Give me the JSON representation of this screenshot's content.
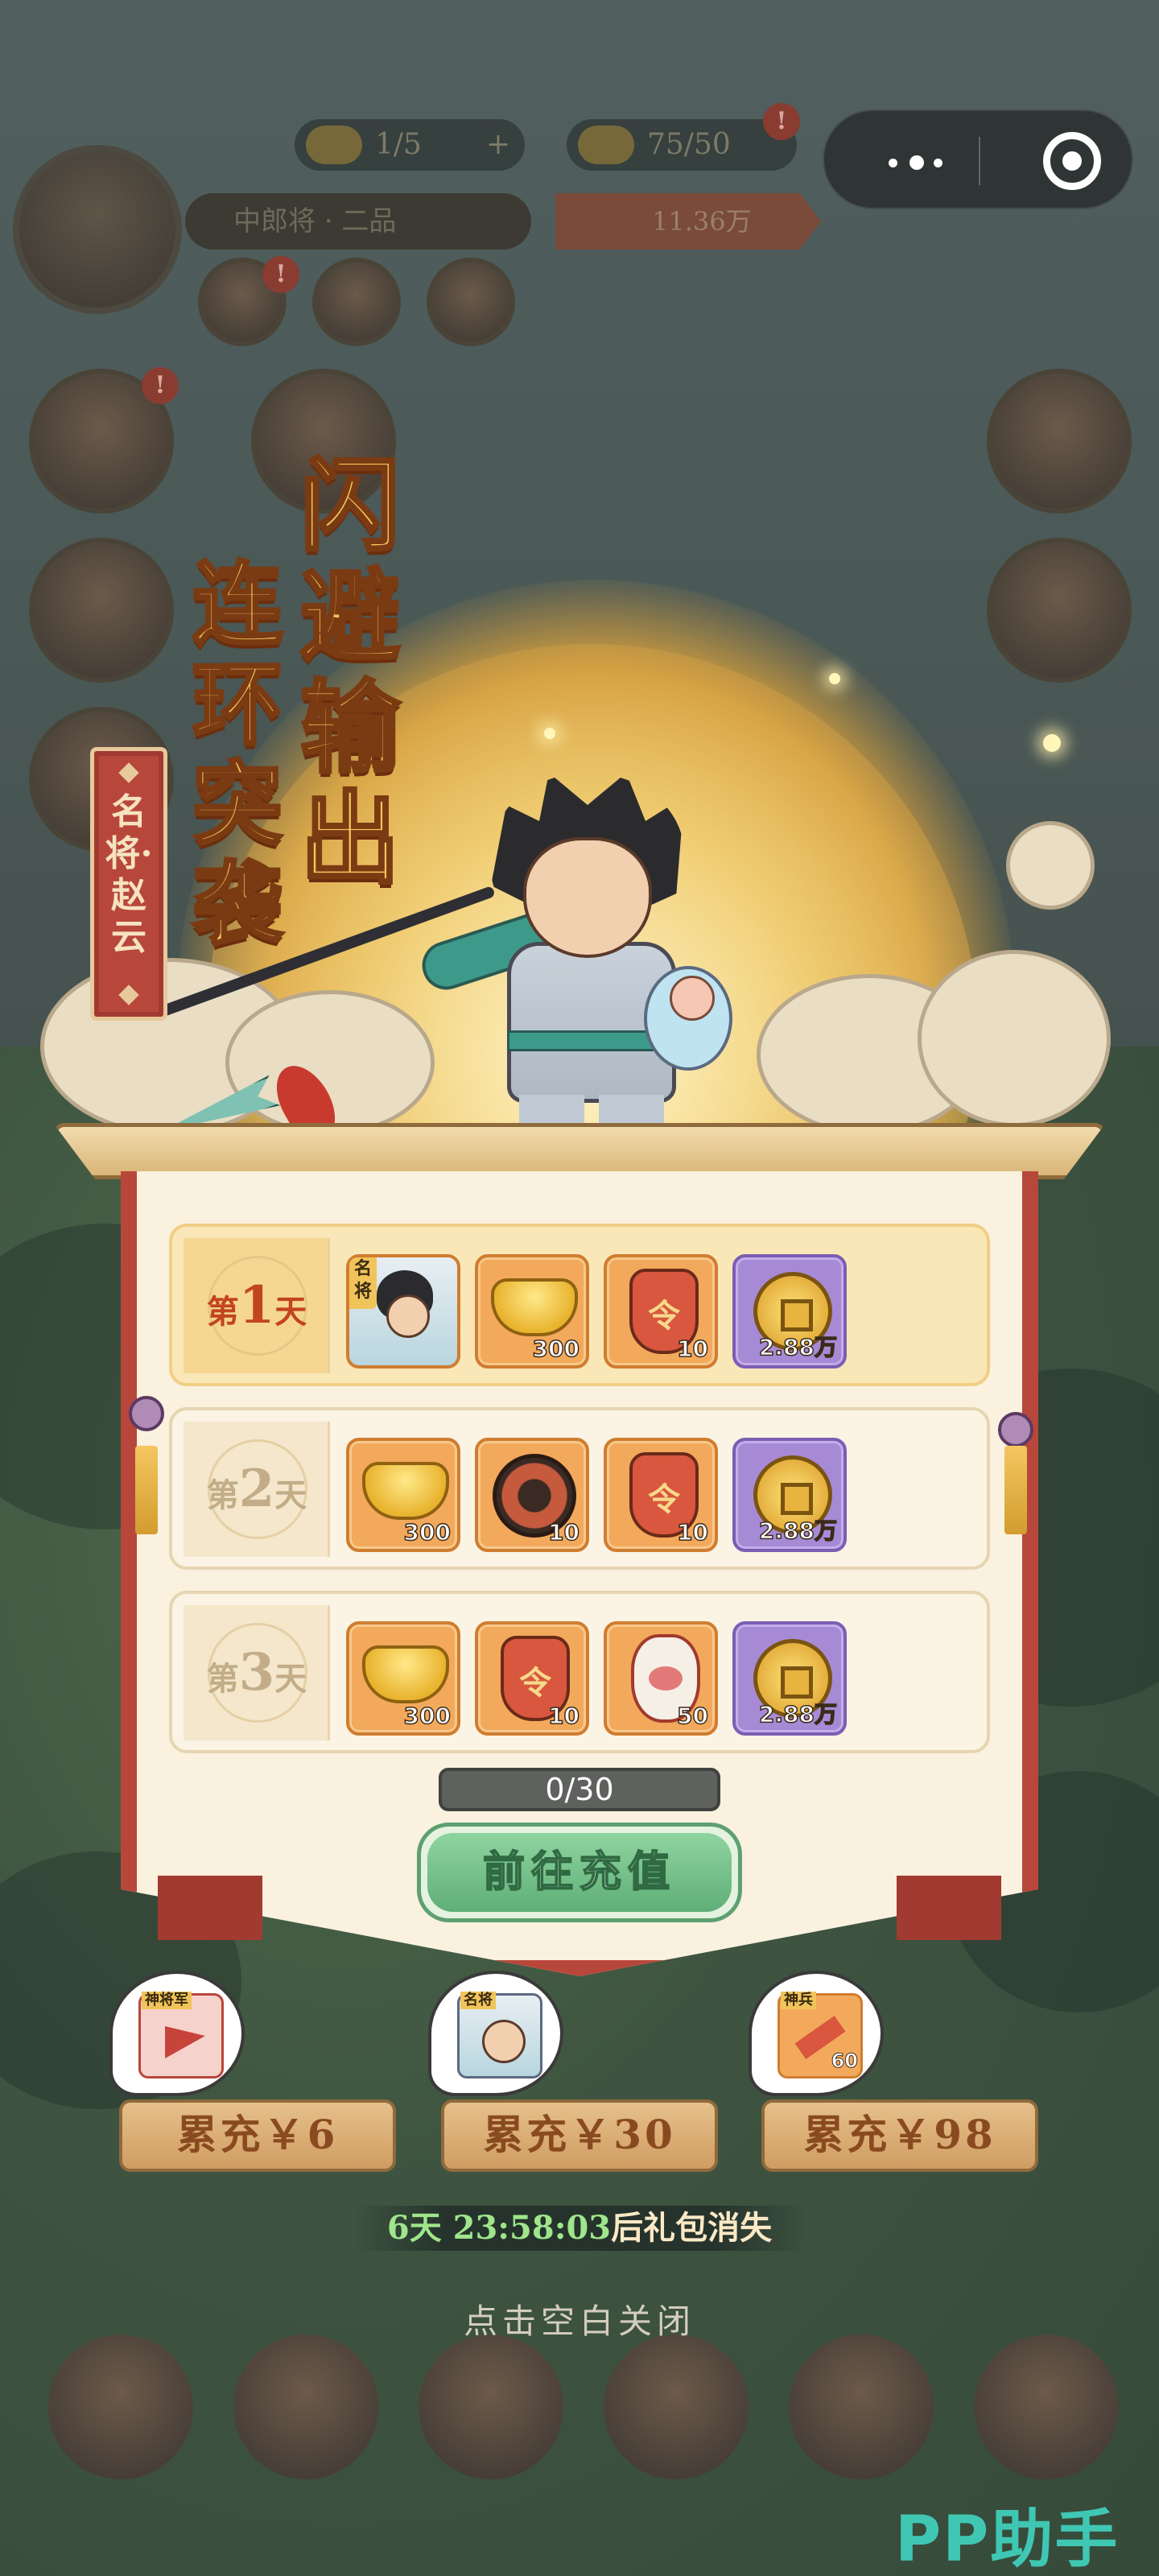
{
  "background": {
    "resource_1": "1/5",
    "resource_2": "75/50",
    "rank": "中郎将 · 二品",
    "power": "11.36万",
    "badge": "!"
  },
  "capsule": {
    "menu_icon": "more-dots-icon",
    "close_icon": "target-close-icon"
  },
  "banner": {
    "title_main": "闪避输出",
    "title_sub": "连环突袭",
    "hero_tag": "名将·赵云"
  },
  "days": [
    {
      "label_prefix": "第",
      "label_num": "1",
      "label_suffix": "天",
      "active": true,
      "items": [
        {
          "icon": "hero-portrait",
          "tag": "名将",
          "count": ""
        },
        {
          "icon": "gold-ingot",
          "count": "300"
        },
        {
          "icon": "command-token",
          "count": "10"
        },
        {
          "icon": "copper-coin",
          "count": "2.88万"
        }
      ]
    },
    {
      "label_prefix": "第",
      "label_num": "2",
      "label_suffix": "天",
      "active": false,
      "items": [
        {
          "icon": "gold-ingot",
          "count": "300"
        },
        {
          "icon": "compass",
          "count": "10"
        },
        {
          "icon": "command-token",
          "count": "10"
        },
        {
          "icon": "copper-coin",
          "count": "2.88万"
        }
      ]
    },
    {
      "label_prefix": "第",
      "label_num": "3",
      "label_suffix": "天",
      "active": false,
      "items": [
        {
          "icon": "gold-ingot",
          "count": "300"
        },
        {
          "icon": "command-token",
          "count": "10"
        },
        {
          "icon": "porcelain-vase",
          "count": "50"
        },
        {
          "icon": "copper-coin",
          "count": "2.88万"
        }
      ]
    }
  ],
  "progress": {
    "text": "0/30",
    "fraction": 0
  },
  "recharge_button": "前往充值",
  "tiers": [
    {
      "label": "累充￥6",
      "tag": "神将军",
      "icon": "banner-flag"
    },
    {
      "label": "累充￥30",
      "tag": "名将",
      "icon": "hero-portrait"
    },
    {
      "label": "累充￥98",
      "tag": "神兵",
      "count": "60",
      "icon": "divine-weapon"
    }
  ],
  "timer": {
    "time": "6天 23:58:03",
    "suffix": "后礼包消失"
  },
  "close_hint": "点击空白关闭",
  "watermark": "PP助手",
  "colors": {
    "accent_gold": "#f5c75c",
    "board_red": "#b8473b",
    "button_green": "#5fae78",
    "item_orange": "#f3a95b",
    "item_purple": "#a78ad6",
    "timer_green": "#9fe58b"
  }
}
